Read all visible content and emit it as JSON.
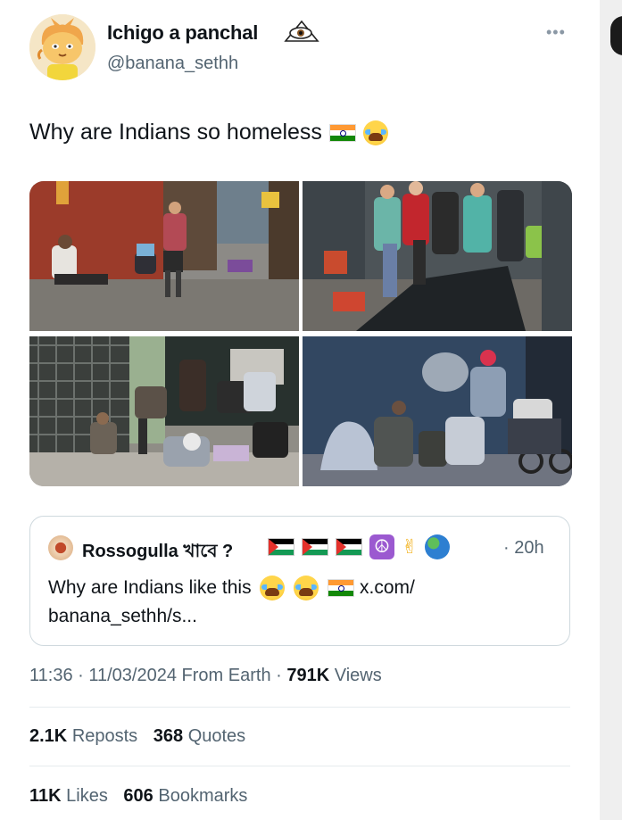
{
  "tweet": {
    "display_name": "Ichigo a panchal",
    "handle": "@banana_sethh",
    "text": "Why are Indians so homeless",
    "text_emojis": [
      "india-flag",
      "loudly-crying-face"
    ],
    "more_label": "•••"
  },
  "media": {
    "count": 4,
    "images": [
      "photo-1",
      "photo-2",
      "photo-3",
      "photo-4"
    ]
  },
  "quote": {
    "display_name": "Rossogulla খাবে ?",
    "name_emojis": [
      "palestine-flag",
      "palestine-flag",
      "palestine-flag",
      "peace-symbol",
      "victory-hand",
      "globe"
    ],
    "time": "· 20h",
    "text_line1": "Why are Indians like this",
    "text_emojis": [
      "loudly-crying-face",
      "loudly-crying-face",
      "india-flag"
    ],
    "link_start": "x.com/",
    "link_end": "banana_sethh/s..."
  },
  "meta": {
    "time": "11:36",
    "date": "11/03/2024",
    "source": "From Earth",
    "views_count": "791K",
    "views_label": "Views"
  },
  "stats": {
    "reposts_count": "2.1K",
    "reposts_label": "Reposts",
    "quotes_count": "368",
    "quotes_label": "Quotes",
    "likes_count": "11K",
    "likes_label": "Likes",
    "bookmarks_count": "606",
    "bookmarks_label": "Bookmarks"
  },
  "colors": {
    "text_primary": "#0f1419",
    "text_secondary": "#536471",
    "border": "#cfd9de"
  }
}
